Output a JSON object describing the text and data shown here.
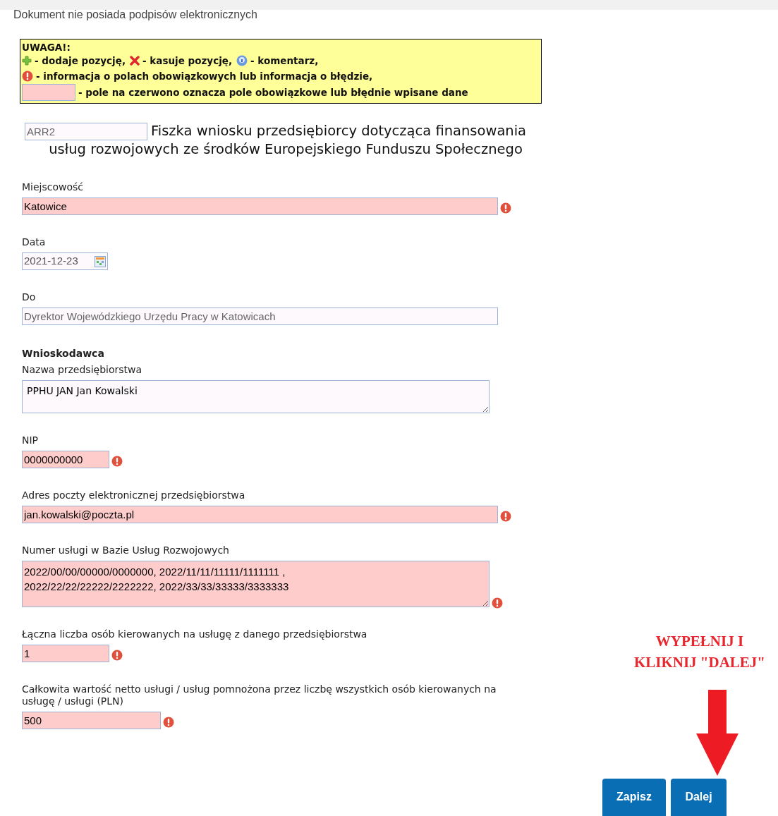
{
  "notice": "Dokument nie posiada podpisów elektronicznych",
  "legend": {
    "title": "UWAGA!:",
    "lines": [
      [
        {
          "kind": "add",
          "text": "- dodaje pozycję,"
        },
        {
          "kind": "delete",
          "text": "- kasuje pozycję,"
        },
        {
          "kind": "info",
          "text": "- komentarz,"
        }
      ],
      [
        {
          "kind": "error",
          "text": "- informacja o polach obowiązkowych lub informacja o błędzie,"
        }
      ],
      [
        {
          "kind": "swatch",
          "text": "- pole na czerwono oznacza pole obowiązkowe lub błędnie wpisane dane"
        }
      ]
    ]
  },
  "form_code": {
    "value": "ARR2"
  },
  "form_title": [
    "Fiszka wniosku przedsiębiorcy dotycząca finansowania",
    "usług rozwojowych ze środków Europejskiego Funduszu Społecznego"
  ],
  "fields": [
    {
      "kind": "wide",
      "label": "Miejscowość",
      "value": "Katowice",
      "error": true,
      "disabled": false
    },
    {
      "kind": "date",
      "label": "Data",
      "value": "2021-12-23",
      "error": false,
      "disabled": false
    },
    {
      "kind": "wide",
      "label": "Do",
      "value": "Dyrektor Wojewódzkiego Urzędu Pracy w Katowicach",
      "error": false,
      "disabled": true
    },
    {
      "kind": "textarea",
      "heading": "Wnioskodawca",
      "label": "Nazwa przedsiębiorstwa",
      "value": "PPHU JAN Jan Kowalski",
      "error": false,
      "disabled": false
    },
    {
      "kind": "short",
      "label": "NIP",
      "value": "0000000000",
      "error": true,
      "disabled": false
    },
    {
      "kind": "wide",
      "label": "Adres poczty elektronicznej przedsiębiorstwa",
      "value": "jan.kowalski@poczta.pl",
      "error": true,
      "disabled": false
    },
    {
      "kind": "textarea_tall",
      "label": "Numer usługi w Bazie Usług Rozwojowych",
      "value": "2022/00/00/00000/0000000, 2022/11/11/11111/1111111 ,\n2022/22/22/22222/2222222, 2022/33/33/33333/3333333",
      "error": true,
      "disabled": false
    },
    {
      "kind": "short",
      "label": "Łączna liczba osób kierowanych na usługę z danego przedsiębiorstwa",
      "value": "1",
      "error": true,
      "disabled": false
    },
    {
      "kind": "medium",
      "label": "Całkowita wartość netto usługi / usług pomnożona przez liczbę wszystkich osób kierowanych na usługę / usługi (PLN)",
      "value": "500",
      "error": true,
      "disabled": false
    }
  ],
  "annotation": [
    "WYPEŁNIJ I",
    "KLIKNIJ \"DALEJ\""
  ],
  "buttons": [
    "Zapisz",
    "Dalej"
  ]
}
